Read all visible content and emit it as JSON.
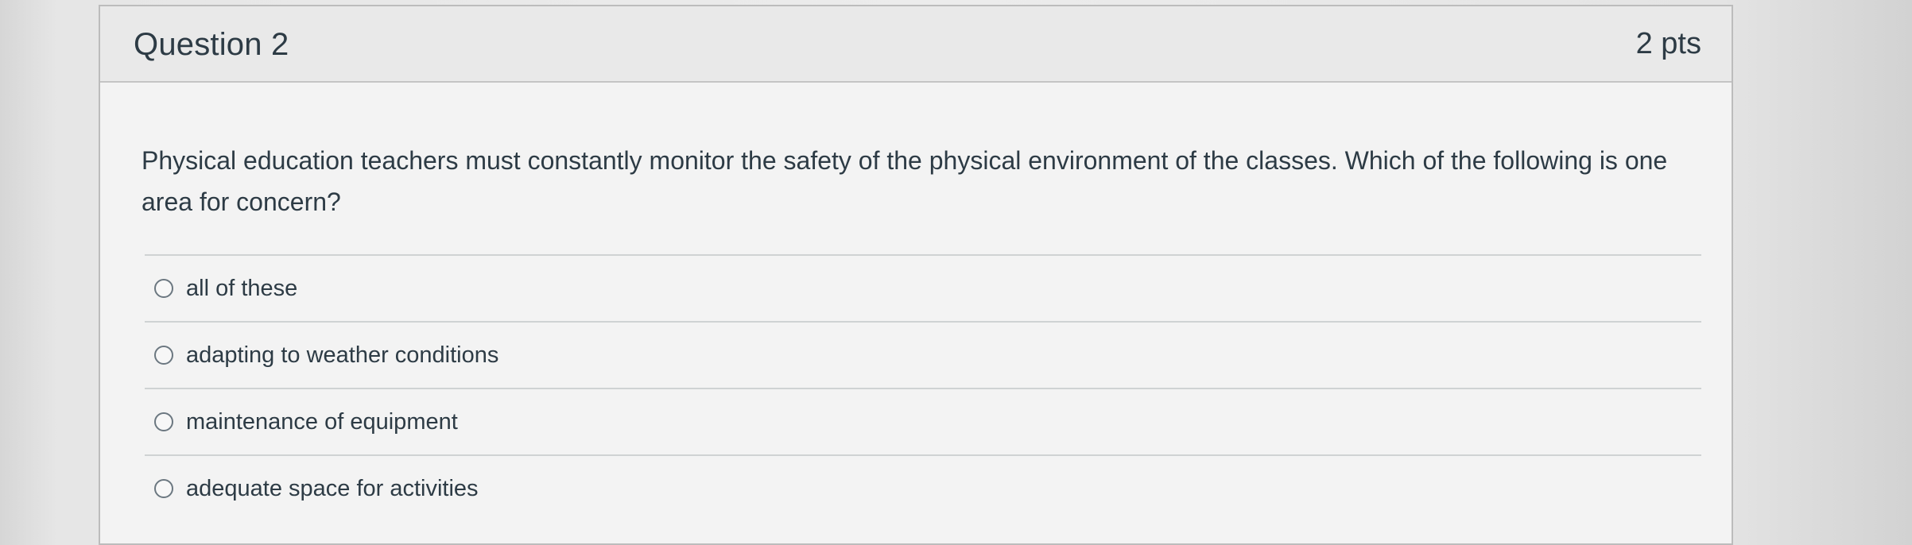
{
  "question": {
    "title": "Question 2",
    "points": "2 pts",
    "text": "Physical education teachers must constantly monitor the safety of the physical environment of the classes. Which of the following is one area for concern?",
    "answers": [
      {
        "label": "all of these",
        "selected": false
      },
      {
        "label": "adapting to weather conditions",
        "selected": false
      },
      {
        "label": "maintenance of equipment",
        "selected": false
      },
      {
        "label": "adequate space for activities",
        "selected": false
      }
    ]
  }
}
